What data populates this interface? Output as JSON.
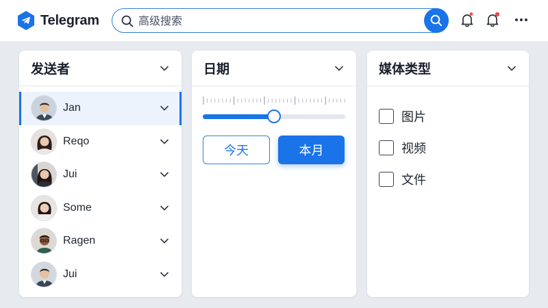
{
  "app": {
    "name": "Telegram",
    "brand_color": "#1a73e8"
  },
  "search": {
    "placeholder": "高级搜索",
    "value": "",
    "icon": "search-icon",
    "button_icon": "search-icon"
  },
  "header_actions": [
    {
      "icon": "bell-icon",
      "has_badge": true,
      "badge_color": "#e84a4a"
    },
    {
      "icon": "bell-outline-icon",
      "has_badge": true,
      "badge_color": "#e84a4a"
    },
    {
      "icon": "more-horizontal-icon"
    }
  ],
  "sender_panel": {
    "title": "发送者",
    "items": [
      {
        "name": "Jan",
        "active": true,
        "avatar": "avatar-man-suit"
      },
      {
        "name": "Reqo",
        "active": false,
        "avatar": "avatar-woman-dark-hair"
      },
      {
        "name": "Jui",
        "active": false,
        "avatar": "avatar-woman-long-hair"
      },
      {
        "name": "Some",
        "active": false,
        "avatar": "avatar-woman-short-hair"
      },
      {
        "name": "Ragen",
        "active": false,
        "avatar": "avatar-man-glasses"
      },
      {
        "name": "Jui",
        "active": false,
        "avatar": "avatar-man-young"
      }
    ]
  },
  "date_panel": {
    "title": "日期",
    "slider_fraction": 0.5,
    "today_label": "今天",
    "month_label": "本月",
    "selected": "本月"
  },
  "media_panel": {
    "title": "媒体类型",
    "options": [
      {
        "label": "图片",
        "checked": false
      },
      {
        "label": "视频",
        "checked": false
      },
      {
        "label": "文件",
        "checked": false
      }
    ]
  }
}
